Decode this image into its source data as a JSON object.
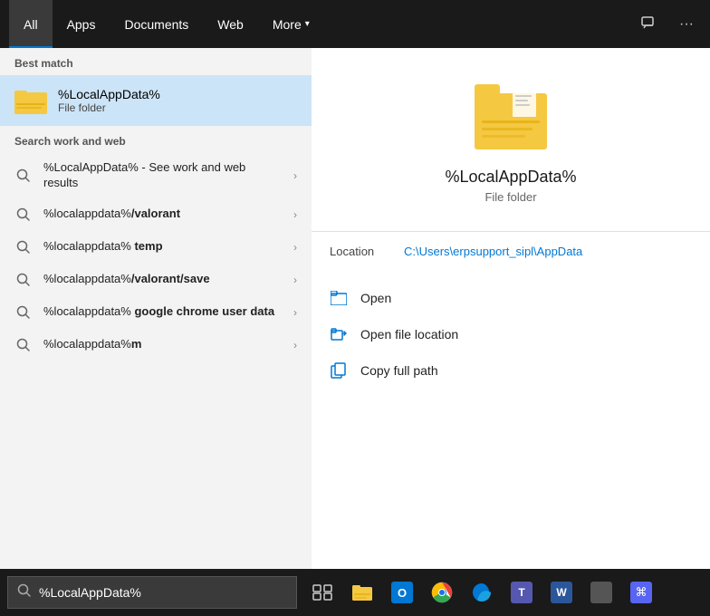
{
  "nav": {
    "tabs": [
      {
        "id": "all",
        "label": "All",
        "active": true
      },
      {
        "id": "apps",
        "label": "Apps"
      },
      {
        "id": "documents",
        "label": "Documents"
      },
      {
        "id": "web",
        "label": "Web"
      },
      {
        "id": "more",
        "label": "More",
        "hasChevron": true
      }
    ],
    "icons": {
      "feedback": "💬",
      "more_options": "···"
    }
  },
  "best_match": {
    "section_label": "Best match",
    "item": {
      "title": "%LocalAppData%",
      "subtitle": "File folder"
    }
  },
  "search_web": {
    "section_label": "Search work and web",
    "results": [
      {
        "text_parts": [
          {
            "text": "%LocalAppData%",
            "bold": false
          },
          {
            "text": " - See work and web results",
            "bold": false
          }
        ],
        "display": "%LocalAppData% - See work and web results"
      },
      {
        "display": "%localappdata%/valorant",
        "bold_start": 0,
        "bold_end": 14
      },
      {
        "display": "%localappdata% temp",
        "normal": "%localappdata% ",
        "bold": "temp"
      },
      {
        "display": "%localappdata%/valorant/save",
        "bold_start": 0,
        "bold_end": 14
      },
      {
        "display": "%localappdata% google chrome user data",
        "normal": "%localappdata% ",
        "bold": "google chrome user data"
      },
      {
        "display": "%localappdata%m",
        "bold_start": 0,
        "bold_end": 14
      }
    ]
  },
  "right_panel": {
    "app_name": "%LocalAppData%",
    "app_type": "File folder",
    "location_label": "Location",
    "location_path": "C:\\Users\\erpsupport_sipl\\AppData",
    "actions": [
      {
        "id": "open",
        "label": "Open"
      },
      {
        "id": "open_file_location",
        "label": "Open file location"
      },
      {
        "id": "copy_full_path",
        "label": "Copy full path"
      }
    ]
  },
  "taskbar": {
    "search_value": "%LocalAppData%",
    "search_placeholder": "%LocalAppData%"
  }
}
